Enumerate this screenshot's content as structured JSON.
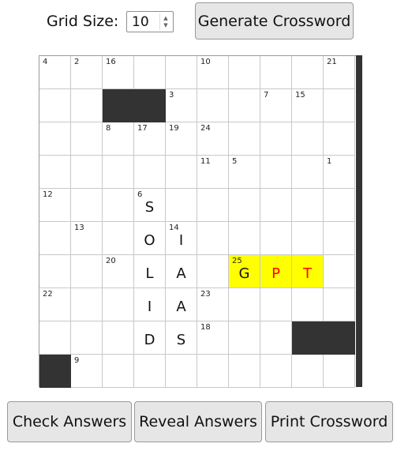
{
  "controls": {
    "grid_size_label": "Grid Size:",
    "grid_size_value": "10",
    "generate_label": "Generate Crossword"
  },
  "grid": {
    "rows": 10,
    "cols": 10,
    "black_cells": [
      [
        1,
        2
      ],
      [
        1,
        3
      ],
      [
        8,
        8
      ],
      [
        8,
        9
      ],
      [
        9,
        0
      ]
    ],
    "highlighted_cells": [
      [
        6,
        6
      ],
      [
        6,
        7
      ],
      [
        6,
        8
      ]
    ],
    "numbers": [
      {
        "r": 0,
        "c": 0,
        "n": "4"
      },
      {
        "r": 0,
        "c": 1,
        "n": "2"
      },
      {
        "r": 0,
        "c": 2,
        "n": "16"
      },
      {
        "r": 0,
        "c": 5,
        "n": "10"
      },
      {
        "r": 0,
        "c": 9,
        "n": "21"
      },
      {
        "r": 1,
        "c": 4,
        "n": "3"
      },
      {
        "r": 1,
        "c": 7,
        "n": "7"
      },
      {
        "r": 1,
        "c": 8,
        "n": "15"
      },
      {
        "r": 2,
        "c": 2,
        "n": "8"
      },
      {
        "r": 2,
        "c": 3,
        "n": "17"
      },
      {
        "r": 2,
        "c": 4,
        "n": "19"
      },
      {
        "r": 2,
        "c": 5,
        "n": "24"
      },
      {
        "r": 3,
        "c": 5,
        "n": "11"
      },
      {
        "r": 3,
        "c": 6,
        "n": "5"
      },
      {
        "r": 3,
        "c": 9,
        "n": "1"
      },
      {
        "r": 4,
        "c": 0,
        "n": "12"
      },
      {
        "r": 4,
        "c": 3,
        "n": "6"
      },
      {
        "r": 5,
        "c": 1,
        "n": "13"
      },
      {
        "r": 5,
        "c": 4,
        "n": "14"
      },
      {
        "r": 6,
        "c": 2,
        "n": "20"
      },
      {
        "r": 6,
        "c": 6,
        "n": "25"
      },
      {
        "r": 7,
        "c": 0,
        "n": "22"
      },
      {
        "r": 7,
        "c": 5,
        "n": "23"
      },
      {
        "r": 8,
        "c": 5,
        "n": "18"
      },
      {
        "r": 9,
        "c": 1,
        "n": "9"
      }
    ],
    "letters": [
      {
        "r": 4,
        "c": 3,
        "ch": "S"
      },
      {
        "r": 5,
        "c": 3,
        "ch": "O"
      },
      {
        "r": 5,
        "c": 4,
        "ch": "I"
      },
      {
        "r": 6,
        "c": 3,
        "ch": "L"
      },
      {
        "r": 6,
        "c": 4,
        "ch": "A"
      },
      {
        "r": 6,
        "c": 6,
        "ch": "G"
      },
      {
        "r": 6,
        "c": 7,
        "ch": "P",
        "color": "red"
      },
      {
        "r": 6,
        "c": 8,
        "ch": "T",
        "color": "red"
      },
      {
        "r": 7,
        "c": 3,
        "ch": "I"
      },
      {
        "r": 7,
        "c": 4,
        "ch": "A"
      },
      {
        "r": 8,
        "c": 3,
        "ch": "D"
      },
      {
        "r": 8,
        "c": 4,
        "ch": "S"
      }
    ]
  },
  "actions": {
    "check_label": "Check Answers",
    "reveal_label": "Reveal Answers",
    "print_label": "Print Crossword"
  }
}
